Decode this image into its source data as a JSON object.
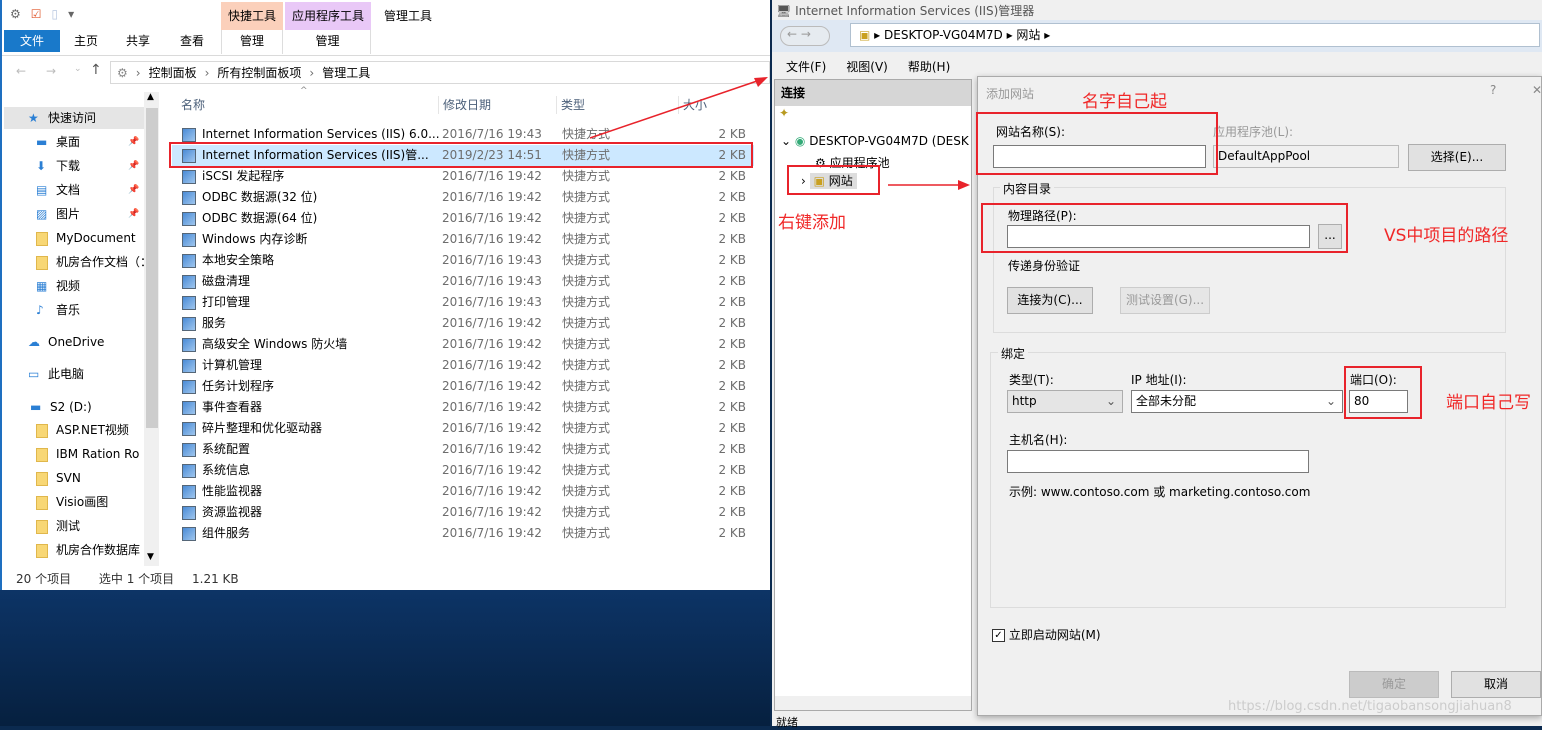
{
  "explorer": {
    "ribbon": {
      "file": "文件",
      "tabs": [
        "主页",
        "共享",
        "查看"
      ],
      "ctx1": "快捷工具",
      "ctx1_tab": "管理",
      "ctx2": "应用程序工具",
      "ctx2_tab": "管理",
      "title": "管理工具",
      "ctx1_color": "#fbd0bb",
      "ctx2_color": "#e9c8f7"
    },
    "breadcrumb": [
      "控制面板",
      "所有控制面板项",
      "管理工具"
    ],
    "nav": [
      {
        "label": "快速访问",
        "icon": "star-icon"
      },
      {
        "label": "桌面",
        "icon": "desktop-icon",
        "pin": true
      },
      {
        "label": "下载",
        "icon": "download-icon",
        "pin": true
      },
      {
        "label": "文档",
        "icon": "document-icon",
        "pin": true
      },
      {
        "label": "图片",
        "icon": "picture-icon",
        "pin": true
      },
      {
        "label": "MyDocument",
        "icon": "folder-icon"
      },
      {
        "label": "机房合作文档（：",
        "icon": "folder-icon"
      },
      {
        "label": "视频",
        "icon": "video-icon"
      },
      {
        "label": "音乐",
        "icon": "music-icon"
      },
      {
        "label": "OneDrive",
        "icon": "cloud-icon"
      },
      {
        "label": "此电脑",
        "icon": "computer-icon"
      },
      {
        "label": "S2 (D:)",
        "icon": "drive-icon"
      },
      {
        "label": "ASP.NET视频",
        "icon": "folder-icon"
      },
      {
        "label": "IBM Ration Ro",
        "icon": "folder-icon"
      },
      {
        "label": "SVN",
        "icon": "folder-icon"
      },
      {
        "label": "Visio画图",
        "icon": "folder-icon"
      },
      {
        "label": "测试",
        "icon": "folder-icon"
      },
      {
        "label": "机房合作数据库",
        "icon": "folder-icon"
      }
    ],
    "columns": [
      "名称",
      "修改日期",
      "类型",
      "大小"
    ],
    "files": [
      [
        "Internet Information Services (IIS) 6.0...",
        "2016/7/16 19:43",
        "快捷方式",
        "2 KB"
      ],
      [
        "Internet Information Services (IIS)管...",
        "2019/2/23 14:51",
        "快捷方式",
        "2 KB"
      ],
      [
        "iSCSI 发起程序",
        "2016/7/16 19:42",
        "快捷方式",
        "2 KB"
      ],
      [
        "ODBC 数据源(32 位)",
        "2016/7/16 19:42",
        "快捷方式",
        "2 KB"
      ],
      [
        "ODBC 数据源(64 位)",
        "2016/7/16 19:42",
        "快捷方式",
        "2 KB"
      ],
      [
        "Windows 内存诊断",
        "2016/7/16 19:42",
        "快捷方式",
        "2 KB"
      ],
      [
        "本地安全策略",
        "2016/7/16 19:43",
        "快捷方式",
        "2 KB"
      ],
      [
        "磁盘清理",
        "2016/7/16 19:43",
        "快捷方式",
        "2 KB"
      ],
      [
        "打印管理",
        "2016/7/16 19:43",
        "快捷方式",
        "2 KB"
      ],
      [
        "服务",
        "2016/7/16 19:42",
        "快捷方式",
        "2 KB"
      ],
      [
        "高级安全 Windows 防火墙",
        "2016/7/16 19:42",
        "快捷方式",
        "2 KB"
      ],
      [
        "计算机管理",
        "2016/7/16 19:42",
        "快捷方式",
        "2 KB"
      ],
      [
        "任务计划程序",
        "2016/7/16 19:42",
        "快捷方式",
        "2 KB"
      ],
      [
        "事件查看器",
        "2016/7/16 19:42",
        "快捷方式",
        "2 KB"
      ],
      [
        "碎片整理和优化驱动器",
        "2016/7/16 19:42",
        "快捷方式",
        "2 KB"
      ],
      [
        "系统配置",
        "2016/7/16 19:42",
        "快捷方式",
        "2 KB"
      ],
      [
        "系统信息",
        "2016/7/16 19:42",
        "快捷方式",
        "2 KB"
      ],
      [
        "性能监视器",
        "2016/7/16 19:42",
        "快捷方式",
        "2 KB"
      ],
      [
        "资源监视器",
        "2016/7/16 19:42",
        "快捷方式",
        "2 KB"
      ],
      [
        "组件服务",
        "2016/7/16 19:42",
        "快捷方式",
        "2 KB"
      ]
    ],
    "selected_index": 1,
    "status": {
      "count": "20 个项目",
      "selected": "选中 1 个项目",
      "size": "1.21 KB"
    }
  },
  "iis": {
    "title": "Internet Information Services (IIS)管理器",
    "address": [
      "DESKTOP-VG04M7D",
      "网站"
    ],
    "menu": [
      "文件(F)",
      "视图(V)",
      "帮助(H)"
    ],
    "connections_title": "连接",
    "tree": {
      "server": "DESKTOP-VG04M7D (DESK",
      "app_pools": "应用程序池",
      "sites": "网站"
    },
    "status": "就绪"
  },
  "dialog": {
    "title": "添加网站",
    "help": "?",
    "close": "✕",
    "site_name_label": "网站名称(S):",
    "site_name": "",
    "app_pool_label": "应用程序池(L):",
    "app_pool": "DefaultAppPool",
    "select_button": "选择(E)...",
    "content_dir": "内容目录",
    "physical_path_label": "物理路径(P):",
    "physical_path": "",
    "browse_button": "...",
    "pass_auth": "传递身份验证",
    "connect_as": "连接为(C)...",
    "test_settings": "测试设置(G)...",
    "binding": "绑定",
    "type_label": "类型(T):",
    "type": "http",
    "ip_label": "IP 地址(I):",
    "ip": "全部未分配",
    "port_label": "端口(O):",
    "port": "80",
    "host_label": "主机名(H):",
    "host": "",
    "example": "示例: www.contoso.com 或 marketing.contoso.com",
    "start_now": "立即启动网站(M)",
    "start_now_checked": true,
    "ok": "确定",
    "cancel": "取消"
  },
  "annotations": {
    "name": "名字自己起",
    "right_click": "右键添加",
    "path": "VS中项目的路径",
    "port": "端口自己写",
    "color": "#e8232b"
  },
  "watermark": "https://blog.csdn.net/tigaobansongjiahuan8"
}
